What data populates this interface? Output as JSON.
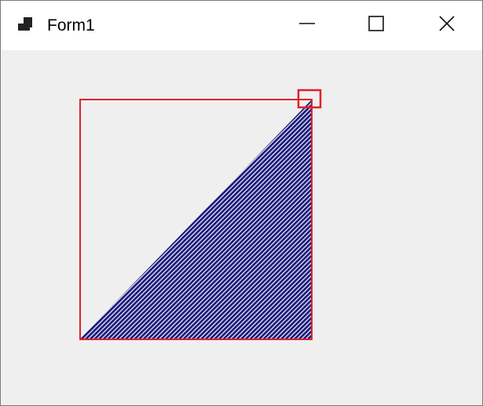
{
  "window": {
    "title": "Form1",
    "icons": {
      "app": "form-app-icon",
      "minimize": "minimize-icon",
      "maximize": "maximize-icon",
      "close": "close-icon"
    }
  },
  "drawing": {
    "shapes": [
      "bounding-rectangle",
      "filled-triangle",
      "corner-handle"
    ],
    "colors": {
      "outline": "#e0202a",
      "fill_dark": "#1a1a7a",
      "fill_light": "#dcdcf0",
      "background": "#efefef"
    }
  }
}
